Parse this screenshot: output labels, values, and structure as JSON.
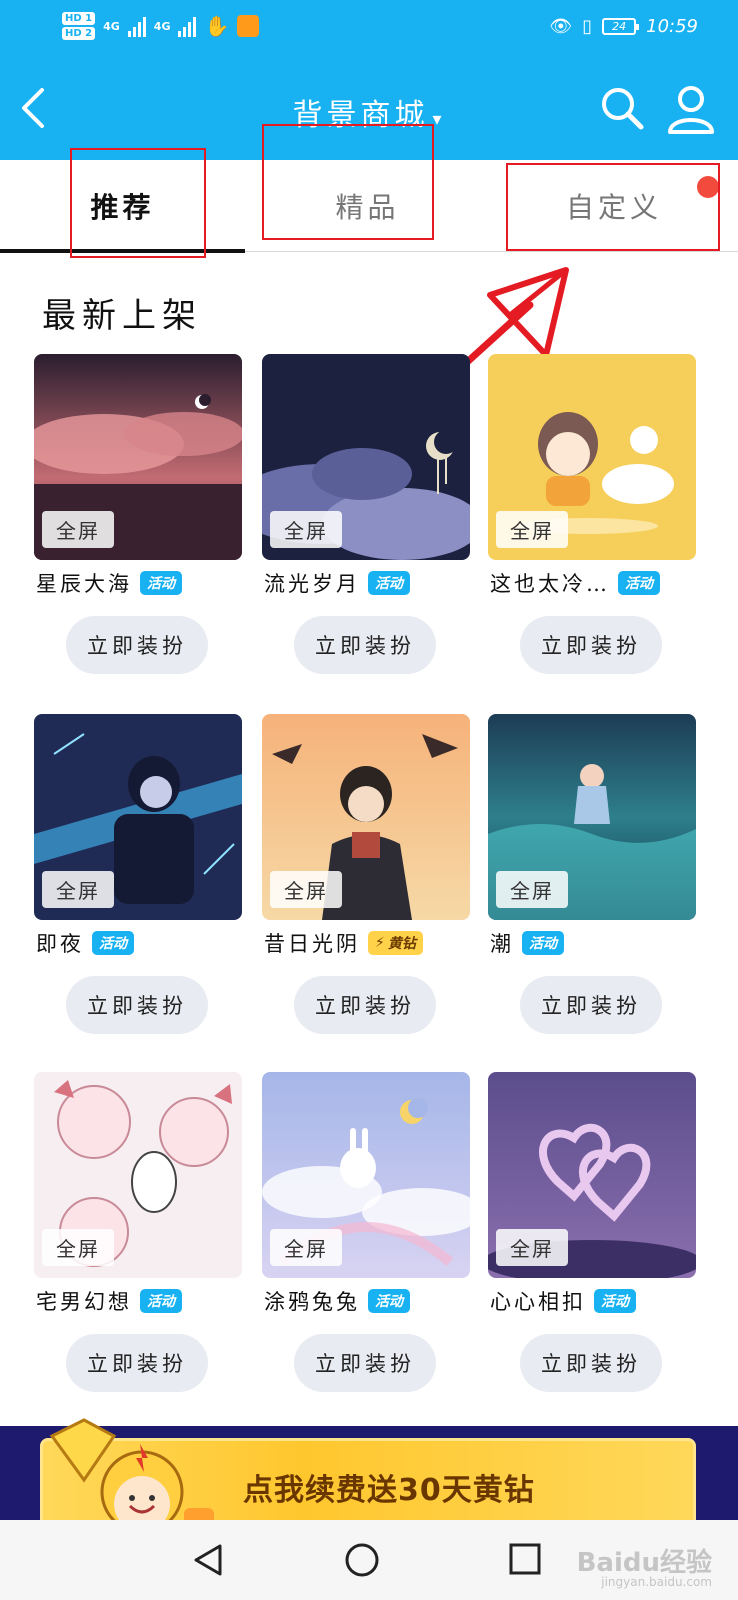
{
  "status_bar": {
    "hd1": "HD 1",
    "hd2": "HD 2",
    "net1": "4G",
    "net2": "4G",
    "battery": "24",
    "time": "10:59"
  },
  "header": {
    "title": "背景商城",
    "caret": "▾"
  },
  "tabs": [
    {
      "label": "推荐",
      "active": true
    },
    {
      "label": "精品",
      "active": false
    },
    {
      "label": "自定义",
      "active": false
    }
  ],
  "section_title": "最新上架",
  "fullscreen_badge": "全屏",
  "dress_button": "立即装扮",
  "items": [
    {
      "name": "星辰大海",
      "tag": "活动",
      "tag_type": "activity"
    },
    {
      "name": "流光岁月",
      "tag": "活动",
      "tag_type": "activity"
    },
    {
      "name": "这也太冷…",
      "tag": "活动",
      "tag_type": "activity"
    },
    {
      "name": "即夜",
      "tag": "活动",
      "tag_type": "activity"
    },
    {
      "name": "昔日光阴",
      "tag": "黄钻",
      "tag_type": "gold"
    },
    {
      "name": "潮",
      "tag": "活动",
      "tag_type": "activity"
    },
    {
      "name": "宅男幻想",
      "tag": "活动",
      "tag_type": "activity"
    },
    {
      "name": "涂鸦兔兔",
      "tag": "活动",
      "tag_type": "activity"
    },
    {
      "name": "心心相扣",
      "tag": "活动",
      "tag_type": "activity"
    }
  ],
  "banner": {
    "text": "点我续费送30天黄钻"
  },
  "watermark": {
    "brand": "Baidu经验",
    "site": "jingyan.baidu.com"
  },
  "colors": {
    "header_blue": "#18b2f3",
    "annotation_red": "#e41b23",
    "tag_blue": "#18b2f3",
    "gold": "#ffd24a"
  }
}
